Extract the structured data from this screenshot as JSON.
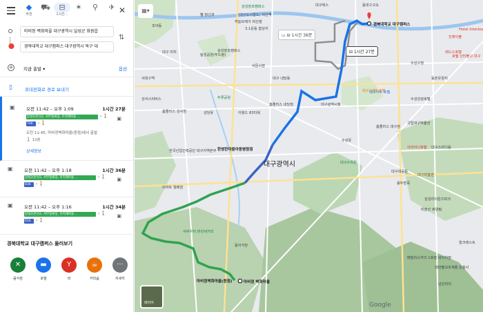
{
  "modes": [
    {
      "icon": "recommended-icon",
      "glyph": "◆",
      "label": "추천"
    },
    {
      "icon": "car-icon",
      "glyph": "⛟",
      "label": ""
    },
    {
      "icon": "transit-icon",
      "glyph": "⊟",
      "label": "1시간..."
    },
    {
      "icon": "walk-icon",
      "glyph": "✶",
      "label": ""
    },
    {
      "icon": "bicycle-icon",
      "glyph": "⚲",
      "label": ""
    },
    {
      "icon": "flight-icon",
      "glyph": "✈",
      "label": ""
    }
  ],
  "origin": "마비정 벽화마을 대구광역시 달성군 화원읍",
  "destination": "경북대학교 대구캠퍼스 대구광역시 북구 대",
  "depart_label": "지금 출발",
  "options_label": "옵션",
  "send_label": "휴대전화로 경로 보내기",
  "routes": [
    {
      "time": "오전 11:42 – 오후 1:09",
      "duration": "1시간 27분",
      "bus_no": "706",
      "line": "달성2(본선2, 서부정류장, 우치재마을 ...",
      "sub1": "오전 11:45, 마비정벽화마을(종점)에서 출발",
      "sub2": "🚶 12분",
      "details": "상세정보"
    },
    {
      "time": "오전 11:42 – 오후 1:18",
      "duration": "1시간 36분",
      "bus_no": "836",
      "line": "달성2(본선2, 서부정류장, 우치재마을 ..."
    },
    {
      "time": "오전 11:42 – 오후 1:16",
      "duration": "1시간 34분",
      "bus_no": "650",
      "line": "달성2(본선2, 서부정류장, 우치재마을 ..."
    }
  ],
  "explore_title": "경북대학교 대구캠퍼스 둘러보기",
  "explore_cats": [
    {
      "label": "음식점",
      "glyph": "✕",
      "color": "#188038",
      "icon": "restaurant-icon"
    },
    {
      "label": "호텔",
      "glyph": "▬",
      "color": "#1a73e8",
      "icon": "hotel-icon"
    },
    {
      "label": "바",
      "glyph": "Y",
      "color": "#d93025",
      "icon": "bar-icon"
    },
    {
      "label": "커피숍",
      "glyph": "☕",
      "color": "#e8710a",
      "icon": "coffee-icon"
    },
    {
      "label": "자세히",
      "glyph": "···",
      "color": "#70757a",
      "icon": "more-icon"
    }
  ],
  "map": {
    "city": "대구광역시",
    "callout_alt": "1시간 36분",
    "callout_sel": "1시간 27분",
    "dest_label": "경북대학교 대구캠퍼스",
    "origin_label": "마비정 벽화마을",
    "layer_label": "레이어",
    "google": "Google",
    "labels": [
      {
        "t": "대구텍스",
        "c": ""
      },
      {
        "t": "동대구고속",
        "c": ""
      },
      {
        "t": "삼성창조캠퍼스",
        "c": "green"
      },
      {
        "t": "조야동",
        "c": ""
      },
      {
        "t": "별 정신과",
        "c": ""
      },
      {
        "t": "하늘모래가 비산점",
        "c": ""
      },
      {
        "t": "3.1운동 발상지",
        "c": ""
      },
      {
        "t": "(대구도시철도) 비산역",
        "c": ""
      },
      {
        "t": "삼성창조캠퍼스",
        "c": ""
      },
      {
        "t": "대구 미처",
        "c": ""
      },
      {
        "t": "달성공원(두드림)",
        "c": ""
      },
      {
        "t": "서문시장",
        "c": ""
      },
      {
        "t": "서대구역",
        "c": ""
      },
      {
        "t": "대구 내당동",
        "c": ""
      },
      {
        "t": "두류공원",
        "c": "green"
      },
      {
        "t": "이월드 83타워",
        "c": ""
      },
      {
        "t": "성당못",
        "c": ""
      },
      {
        "t": "홈플러스 성서점",
        "c": ""
      },
      {
        "t": "성서시외버스",
        "c": ""
      },
      {
        "t": "한국산업인력공단 대구지역본부",
        "c": ""
      },
      {
        "t": "이마트 월배점",
        "c": ""
      },
      {
        "t": "홈플러스 내당점",
        "c": ""
      },
      {
        "t": "대구광역시청",
        "c": ""
      },
      {
        "t": "메리어트 호텔",
        "c": "blue"
      },
      {
        "t": "수성관광호텔",
        "c": ""
      },
      {
        "t": "대구그랜드호텔",
        "c": "orange"
      },
      {
        "t": "국립대구박물관",
        "c": ""
      },
      {
        "t": "대구스타디움",
        "c": ""
      },
      {
        "t": "수성못",
        "c": ""
      },
      {
        "t": "대구대공원",
        "c": ""
      },
      {
        "t": "용두방죽",
        "c": ""
      },
      {
        "t": "아리아나호텔",
        "c": "red"
      },
      {
        "t": "홈플러스 대구점",
        "c": ""
      },
      {
        "t": "대구미술관",
        "c": ""
      },
      {
        "t": "삼성라이온즈파크",
        "c": ""
      },
      {
        "t": "힐크레스트",
        "c": ""
      },
      {
        "t": "패밀리스카이 1호점 네이처점",
        "c": ""
      },
      {
        "t": "대한불교조계종 운흥사",
        "c": ""
      },
      {
        "t": "남산리리",
        "c": ""
      },
      {
        "t": "한영한마음아동병원점",
        "c": "bold"
      },
      {
        "t": "대구수목원",
        "c": "green"
      },
      {
        "t": "비슬산 휴양림",
        "c": ""
      },
      {
        "t": "동이식당",
        "c": ""
      },
      {
        "t": "마비정벽화마을(종점)",
        "c": "bold"
      },
      {
        "t": "서부우비 본리세거리",
        "c": "green"
      },
      {
        "t": "진제이블",
        "c": "red"
      },
      {
        "t": "호텔 인터불고 대구",
        "c": "red"
      },
      {
        "t": "레드스호텔",
        "c": "red"
      },
      {
        "t": "동촌유원지",
        "c": ""
      },
      {
        "t": "수성구청",
        "c": ""
      },
      {
        "t": "Hotel Interburgo EXCO",
        "c": "red"
      }
    ]
  }
}
